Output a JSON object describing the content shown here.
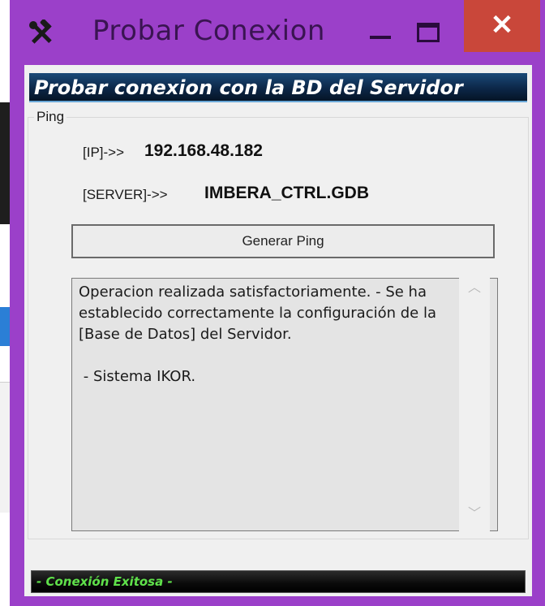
{
  "window": {
    "title": "Probar Conexion",
    "icon": "tools-icon",
    "close_glyph": "✕",
    "accent_color": "#9b40c9",
    "close_color": "#c9473a"
  },
  "header": {
    "title": "Probar conexion con la BD del Servidor"
  },
  "group": {
    "legend": "Ping",
    "ip_label": "[IP]->>",
    "ip_value": "192.168.48.182",
    "server_label": "[SERVER]->>",
    "server_value": "IMBERA_CTRL.GDB"
  },
  "actions": {
    "ping_label": "Generar Ping"
  },
  "result": {
    "text": "Operacion realizada satisfactoriamente. - Se ha establecido correctamente la configuración de la [Base de Datos] del Servidor.\n\n - Sistema IKOR."
  },
  "status": {
    "text": "- Conexión Exitosa -",
    "color": "#5fe14a"
  }
}
